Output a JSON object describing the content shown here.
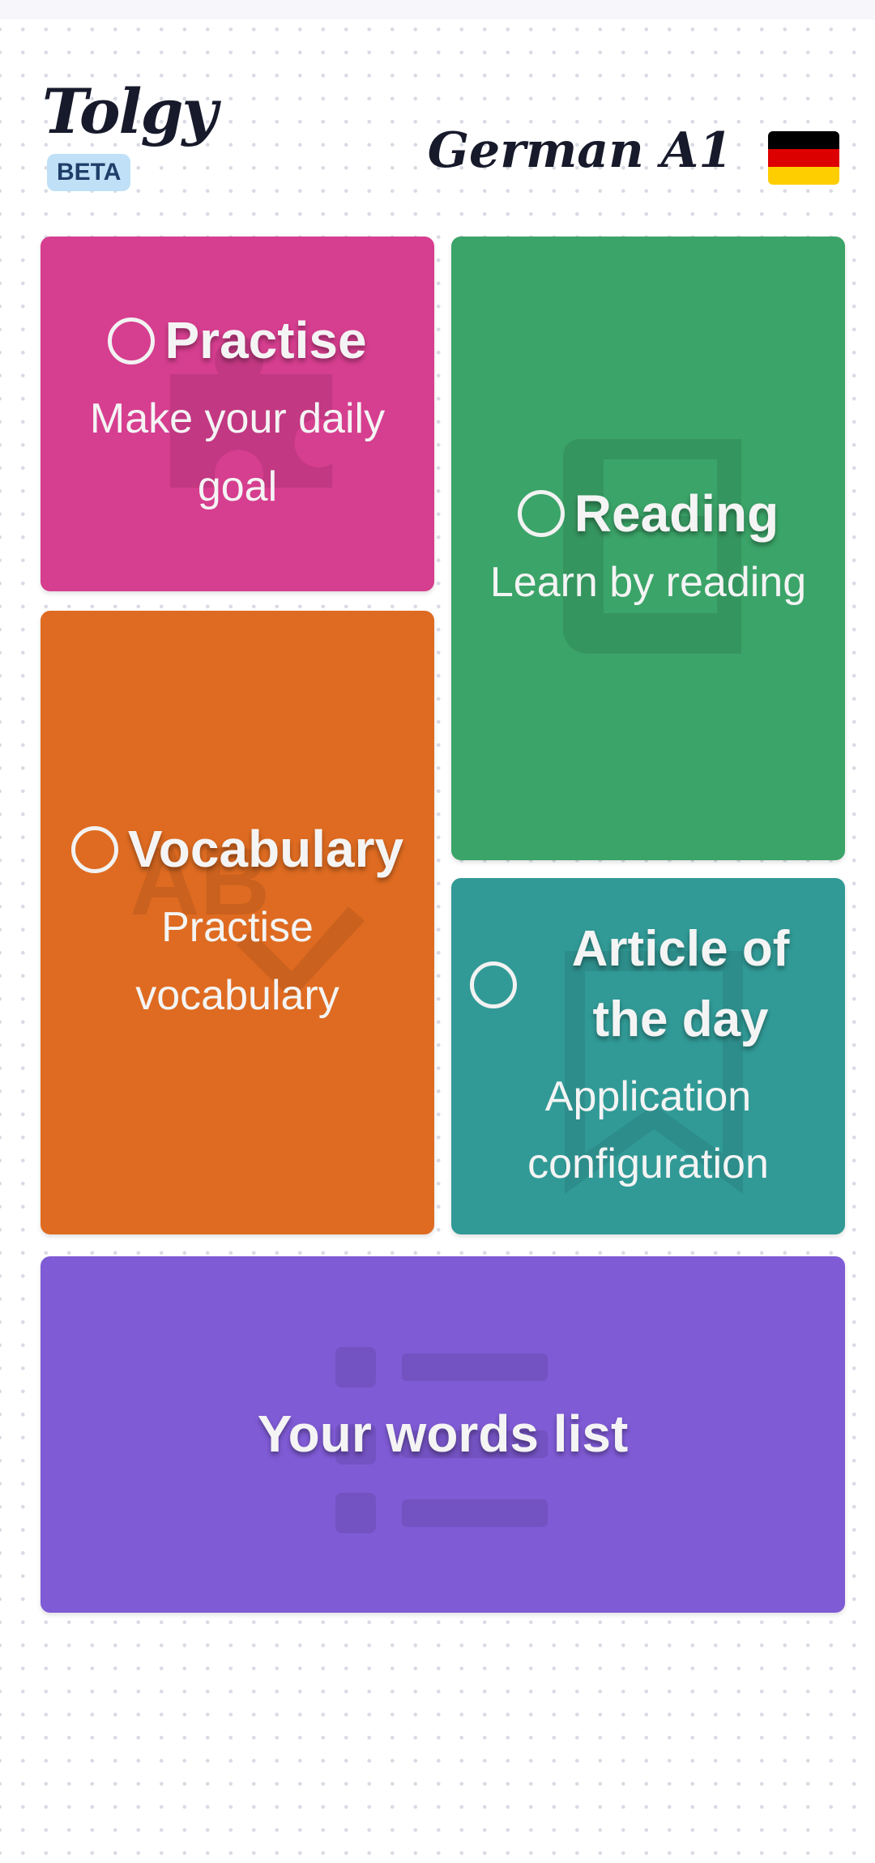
{
  "header": {
    "logo": "Tolgy",
    "badge": "BETA",
    "course": "German A1",
    "flag_icon": "germany-flag-icon"
  },
  "cards": {
    "practise": {
      "title": "Practise",
      "subtitle": "Make your daily goal",
      "color": "#d63e8f",
      "icon": "puzzle-icon"
    },
    "reading": {
      "title": "Reading",
      "subtitle": "Learn by reading",
      "color": "#3ba468",
      "icon": "book-icon"
    },
    "vocabulary": {
      "title": "Vocabulary",
      "subtitle": "Practise vocabulary",
      "color": "#de6b21",
      "icon": "spellcheck-icon"
    },
    "article": {
      "title": "Article of the day",
      "subtitle": "Application configuration",
      "color": "#319a96",
      "icon": "bookmark-icon"
    },
    "words": {
      "title": "Your words list",
      "color": "#7f5bd5",
      "icon": "list-icon"
    }
  }
}
